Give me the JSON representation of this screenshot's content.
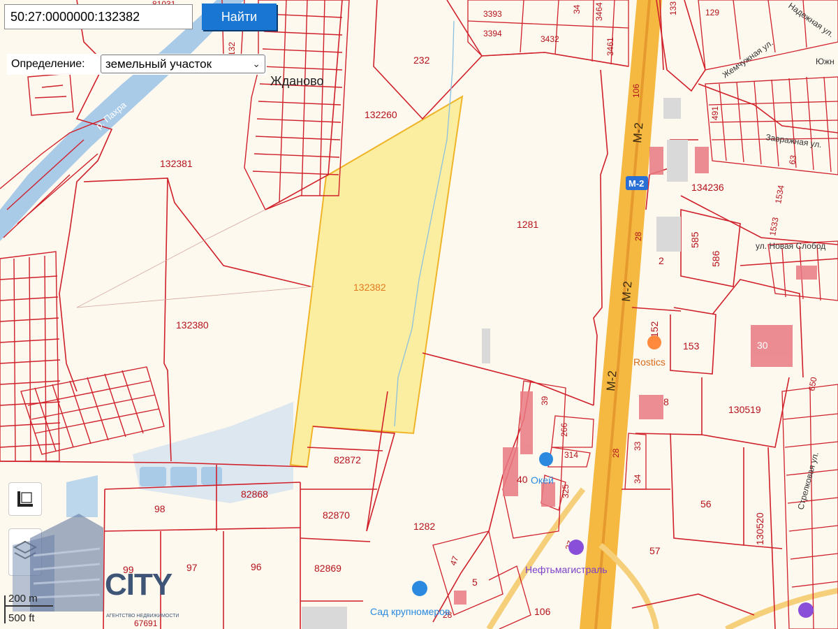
{
  "search": {
    "value": "50:27:0000000:132382",
    "button_label": "Найти"
  },
  "definition": {
    "label": "Определение:",
    "selected": "земельный участок"
  },
  "parcels": {
    "selected": "132382",
    "p132260": "132260",
    "p232": "232",
    "p132381": "132381",
    "p132380": "132380",
    "p1281": "1281",
    "p82872": "82872",
    "p82870": "82870",
    "p82869": "82869",
    "p82868": "82868",
    "p98": "98",
    "p97": "97",
    "p96": "96",
    "p99": "99",
    "p1282": "1282",
    "p134236": "134236",
    "p585": "585",
    "p586": "586",
    "p2": "2",
    "p152": "152",
    "p153": "153",
    "p30": "30",
    "p8": "8",
    "p130519": "130519",
    "p39": "39",
    "p266": "266",
    "p314": "314",
    "p40": "40",
    "p325": "325",
    "p33": "33",
    "p34": "34",
    "p28a": "28",
    "p28b": "28",
    "p56": "56",
    "p57": "57",
    "p130520": "130520",
    "p27": "27",
    "p47": "47",
    "p5": "5",
    "p106a": "106",
    "p106b": "106",
    "p3393": "3393",
    "p3394": "3394",
    "p3432": "3432",
    "p3461": "3461",
    "p129": "129",
    "p491": "491",
    "p1534": "1534",
    "p1533": "1533",
    "p650": "650",
    "p63": "63",
    "p67691": "67691",
    "p81031": "81031",
    "p132x": "132",
    "p3464": "3464",
    "p34x": "34",
    "p133": "133",
    "p28c": "28"
  },
  "places": {
    "village": "Жданово",
    "river": "р. Пахра",
    "highway": "М-2",
    "highway_shield": "М-2",
    "street_zhemchuzhnaya": "Жемчужная ул.",
    "street_novaya_sloboda": "ул. Новая Слобод",
    "street_zavrazhnaya": "Завражная ул.",
    "street_strelkovaya": "Стрелковая ул.",
    "street_yuzh": "Южн",
    "street_nadezhnaya": "Надежная ул."
  },
  "pois": {
    "rostics": "Rostics",
    "neftemagistral": "Нефтьмагистраль",
    "sad": "Сад крупномеров",
    "okey": "Окей"
  },
  "scale": {
    "metric": "200 m",
    "imperial": "500 ft"
  },
  "logo": {
    "name": "CITY",
    "tagline": "АГЕНТСТВО НЕДВИЖИМОСТИ"
  },
  "colors": {
    "parcel_border": "#d0202a",
    "selected_fill": "#fbeea0",
    "selected_border": "#f0b429",
    "highway": "#f5b942",
    "water": "#a9cbe8",
    "button": "#1976d2"
  }
}
